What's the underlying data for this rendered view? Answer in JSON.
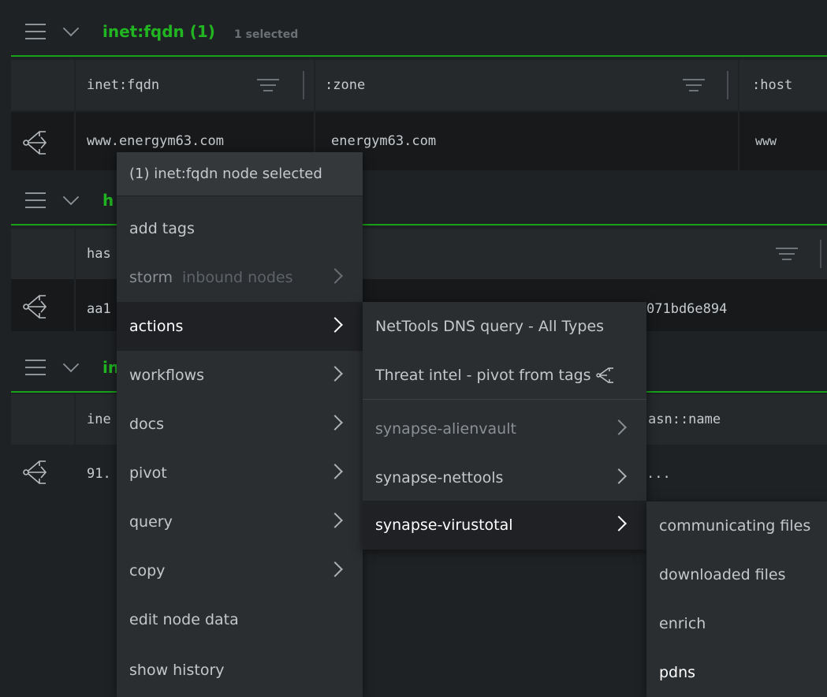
{
  "section1": {
    "title": "inet:fqdn (1)",
    "subtitle": "1 selected",
    "columns": [
      "inet:fqdn",
      ":zone",
      ":host"
    ],
    "row": [
      "www.energym63.com",
      "energym63.com",
      "www"
    ]
  },
  "section2": {
    "title_partial": "h",
    "column_partial": "has",
    "row_partial": "aa1",
    "row_tail": "071bd6e894"
  },
  "section3": {
    "title_partial": "in",
    "column_partial": "ine",
    "column_tail": "asn::name",
    "row_partial": "91.",
    "row_tail": "..."
  },
  "context_menu": {
    "header": "(1) inet:fqdn node selected",
    "items": [
      {
        "label": "add tags"
      },
      {
        "label": "storm",
        "sub": "inbound nodes"
      },
      {
        "label": "actions"
      },
      {
        "label": "workflows"
      },
      {
        "label": "docs"
      },
      {
        "label": "pivot"
      },
      {
        "label": "query"
      },
      {
        "label": "copy"
      },
      {
        "label": "edit node data"
      },
      {
        "label": "show history"
      }
    ]
  },
  "actions_menu": {
    "items": [
      {
        "label": "NetTools DNS query - All Types"
      },
      {
        "label": "Threat intel - pivot from tags"
      },
      {
        "label": "synapse-alienvault"
      },
      {
        "label": "synapse-nettools"
      },
      {
        "label": "synapse-virustotal"
      }
    ]
  },
  "virustotal_menu": {
    "items": [
      {
        "label": "communicating files"
      },
      {
        "label": "downloaded files"
      },
      {
        "label": "enrich"
      },
      {
        "label": "pdns"
      }
    ]
  }
}
